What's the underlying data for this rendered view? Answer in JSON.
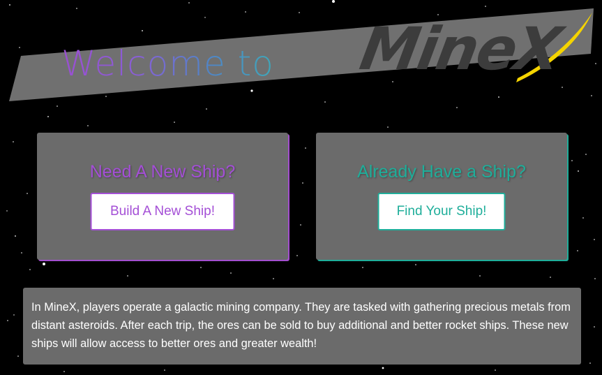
{
  "header": {
    "welcome_text": "Welcome to",
    "logo_text": "MineX"
  },
  "cards": {
    "new_ship": {
      "title": "Need A New Ship?",
      "button_label": "Build A New Ship!"
    },
    "existing_ship": {
      "title": "Already Have a Ship?",
      "button_label": "Find Your Ship!"
    }
  },
  "description": {
    "text": "In MineX, players operate a galactic mining company. They are tasked with gathering precious metals from distant asteroids. After each trip, the ores can be sold to buy additional and better rocket ships. These new ships will allow access to better ores and greater wealth!"
  },
  "colors": {
    "background": "#000000",
    "panel": "#6b6b6b",
    "purple_accent": "#a44fd6",
    "teal_accent": "#1fae9a",
    "logo_swoosh": "#f5d400"
  }
}
